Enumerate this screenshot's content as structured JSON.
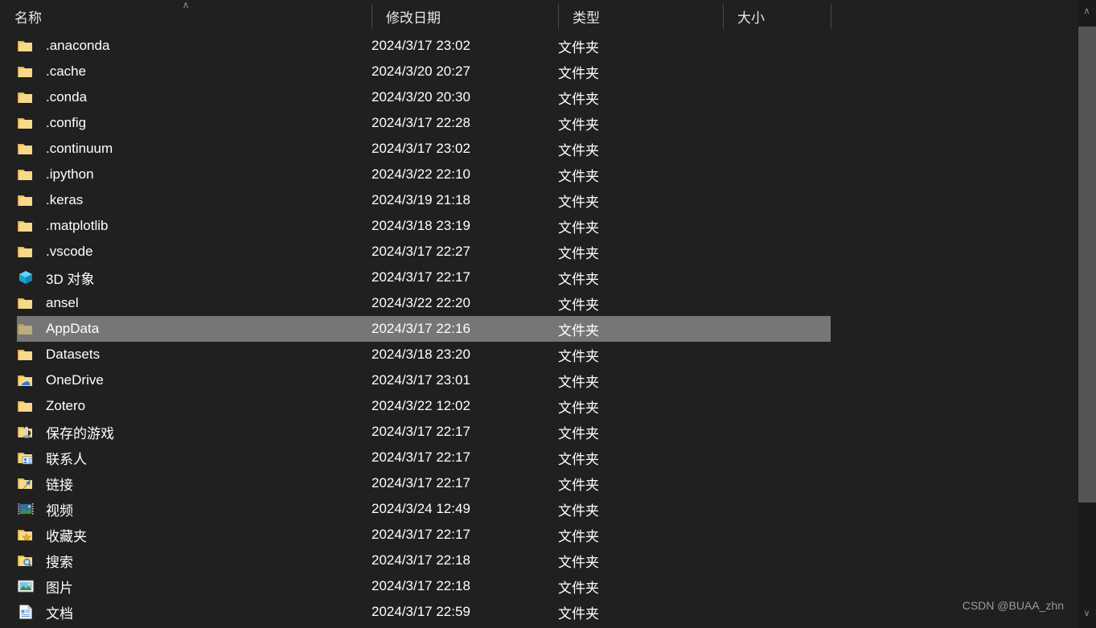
{
  "columns": {
    "name": "名称",
    "date_modified": "修改日期",
    "type": "类型",
    "size": "大小",
    "sort_indicator": "∧"
  },
  "scrollbar": {
    "up_arrow": "∧",
    "down_arrow": "∨"
  },
  "watermark": "CSDN @BUAA_zhn",
  "colors": {
    "background": "#202020",
    "selection": "#767676",
    "folder": "#f5d07a",
    "text": "#ffffff",
    "divider": "#4a4a4a",
    "scrollbar_thumb": "#555555"
  },
  "rows": [
    {
      "name": ".anaconda",
      "date": "2024/3/17 23:02",
      "type": "文件夹",
      "size": "",
      "icon": "folder-icon",
      "selected": false
    },
    {
      "name": ".cache",
      "date": "2024/3/20 20:27",
      "type": "文件夹",
      "size": "",
      "icon": "folder-icon",
      "selected": false
    },
    {
      "name": ".conda",
      "date": "2024/3/20 20:30",
      "type": "文件夹",
      "size": "",
      "icon": "folder-icon",
      "selected": false
    },
    {
      "name": ".config",
      "date": "2024/3/17 22:28",
      "type": "文件夹",
      "size": "",
      "icon": "folder-icon",
      "selected": false
    },
    {
      "name": ".continuum",
      "date": "2024/3/17 23:02",
      "type": "文件夹",
      "size": "",
      "icon": "folder-icon",
      "selected": false
    },
    {
      "name": ".ipython",
      "date": "2024/3/22 22:10",
      "type": "文件夹",
      "size": "",
      "icon": "folder-icon",
      "selected": false
    },
    {
      "name": ".keras",
      "date": "2024/3/19 21:18",
      "type": "文件夹",
      "size": "",
      "icon": "folder-icon",
      "selected": false
    },
    {
      "name": ".matplotlib",
      "date": "2024/3/18 23:19",
      "type": "文件夹",
      "size": "",
      "icon": "folder-icon",
      "selected": false
    },
    {
      "name": ".vscode",
      "date": "2024/3/17 22:27",
      "type": "文件夹",
      "size": "",
      "icon": "folder-icon",
      "selected": false
    },
    {
      "name": "3D 对象",
      "date": "2024/3/17 22:17",
      "type": "文件夹",
      "size": "",
      "icon": "cube-3d-icon",
      "selected": false
    },
    {
      "name": "ansel",
      "date": "2024/3/22 22:20",
      "type": "文件夹",
      "size": "",
      "icon": "folder-icon",
      "selected": false
    },
    {
      "name": "AppData",
      "date": "2024/3/17 22:16",
      "type": "文件夹",
      "size": "",
      "icon": "folder-hidden-icon",
      "selected": true
    },
    {
      "name": "Datasets",
      "date": "2024/3/18 23:20",
      "type": "文件夹",
      "size": "",
      "icon": "folder-icon",
      "selected": false
    },
    {
      "name": "OneDrive",
      "date": "2024/3/17 23:01",
      "type": "文件夹",
      "size": "",
      "icon": "folder-onedrive-icon",
      "selected": false
    },
    {
      "name": "Zotero",
      "date": "2024/3/22 12:02",
      "type": "文件夹",
      "size": "",
      "icon": "folder-icon",
      "selected": false
    },
    {
      "name": "保存的游戏",
      "date": "2024/3/17 22:17",
      "type": "文件夹",
      "size": "",
      "icon": "folder-savedgames-icon",
      "selected": false
    },
    {
      "name": "联系人",
      "date": "2024/3/17 22:17",
      "type": "文件夹",
      "size": "",
      "icon": "folder-contacts-icon",
      "selected": false
    },
    {
      "name": "链接",
      "date": "2024/3/17 22:17",
      "type": "文件夹",
      "size": "",
      "icon": "folder-links-icon",
      "selected": false
    },
    {
      "name": "视频",
      "date": "2024/3/24 12:49",
      "type": "文件夹",
      "size": "",
      "icon": "videos-icon",
      "selected": false
    },
    {
      "name": "收藏夹",
      "date": "2024/3/17 22:17",
      "type": "文件夹",
      "size": "",
      "icon": "folder-favorites-icon",
      "selected": false
    },
    {
      "name": "搜索",
      "date": "2024/3/17 22:18",
      "type": "文件夹",
      "size": "",
      "icon": "folder-search-icon",
      "selected": false
    },
    {
      "name": "图片",
      "date": "2024/3/17 22:18",
      "type": "文件夹",
      "size": "",
      "icon": "pictures-icon",
      "selected": false
    },
    {
      "name": "文档",
      "date": "2024/3/17 22:59",
      "type": "文件夹",
      "size": "",
      "icon": "documents-icon",
      "selected": false
    }
  ]
}
